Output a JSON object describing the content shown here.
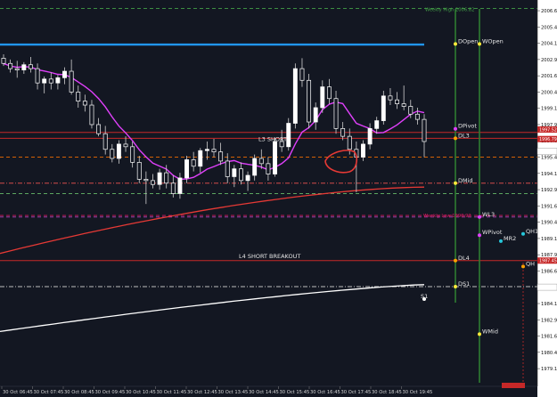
{
  "chart_data": {
    "type": "candlestick",
    "symbol_hint": "",
    "y_ticks": [
      "2006.65",
      "2005.40",
      "2004.15",
      "2002.90",
      "2001.65",
      "2000.40",
      "1999.15",
      "1997.90",
      "1996.65",
      "1995.40",
      "1994.15",
      "1992.90",
      "1991.65",
      "1990.40",
      "1989.15",
      "1987.90",
      "1986.65",
      "1985.40",
      "1984.15",
      "1982.90",
      "1981.65",
      "1980.40",
      "1979.15"
    ],
    "y_range": [
      1978.2,
      2007.2
    ],
    "x_labels": [
      "30 Oct 06:45",
      "30 Oct 07:45",
      "30 Oct 08:45",
      "30 Oct 09:45",
      "30 Oct 10:45",
      "30 Oct 11:45",
      "30 Oct 12:45",
      "30 Oct 13:45",
      "30 Oct 14:45",
      "30 Oct 15:45",
      "30 Oct 16:45",
      "30 Oct 17:45",
      "30 Oct 18:45",
      "30 Oct 19:45"
    ],
    "candles": [
      [
        2003.0,
        2003.3,
        2002.4,
        2002.6
      ],
      [
        2002.6,
        2002.9,
        2001.9,
        2002.2
      ],
      [
        2002.2,
        2002.8,
        2001.5,
        2002.1
      ],
      [
        2002.1,
        2002.7,
        2001.8,
        2002.5
      ],
      [
        2002.5,
        2003.1,
        2001.9,
        2002.2
      ],
      [
        2002.2,
        2002.6,
        2000.6,
        2001.1
      ],
      [
        2001.1,
        2001.6,
        2000.3,
        2001.4
      ],
      [
        2001.4,
        2001.9,
        2000.6,
        2001.1
      ],
      [
        2001.1,
        2001.7,
        2000.6,
        2001.5
      ],
      [
        2001.5,
        2002.3,
        2001.0,
        2002.0
      ],
      [
        2002.0,
        2002.9,
        2000.2,
        2000.4
      ],
      [
        2000.4,
        2000.9,
        1999.2,
        1999.7
      ],
      [
        1999.7,
        2000.2,
        1998.9,
        1999.4
      ],
      [
        1999.4,
        1999.8,
        1997.6,
        1997.9
      ],
      [
        1997.9,
        1998.4,
        1997.0,
        1997.2
      ],
      [
        1997.2,
        1997.8,
        1995.6,
        1996.0
      ],
      [
        1996.0,
        1996.4,
        1995.0,
        1995.3
      ],
      [
        1995.3,
        1996.7,
        1994.9,
        1996.4
      ],
      [
        1996.4,
        1997.0,
        1995.8,
        1996.2
      ],
      [
        1996.2,
        1996.6,
        1994.6,
        1995.0
      ],
      [
        1995.0,
        1995.5,
        1993.4,
        1993.7
      ],
      [
        1993.7,
        1994.3,
        1991.8,
        1993.6
      ],
      [
        1993.6,
        1994.1,
        1993.0,
        1993.3
      ],
      [
        1993.3,
        1994.5,
        1992.9,
        1994.2
      ],
      [
        1994.2,
        1994.8,
        1993.0,
        1993.4
      ],
      [
        1993.4,
        1994.0,
        1992.3,
        1992.6
      ],
      [
        1992.6,
        1994.2,
        1992.2,
        1993.8
      ],
      [
        1993.8,
        1995.5,
        1993.4,
        1995.2
      ],
      [
        1995.2,
        1995.8,
        1994.3,
        1994.7
      ],
      [
        1994.7,
        1996.1,
        1994.2,
        1995.9
      ],
      [
        1995.9,
        1996.6,
        1995.2,
        1996.0
      ],
      [
        1996.0,
        1996.8,
        1995.4,
        1995.8
      ],
      [
        1995.8,
        1996.5,
        1994.8,
        1995.1
      ],
      [
        1995.1,
        1995.7,
        1993.4,
        1993.9
      ],
      [
        1993.9,
        1994.8,
        1993.1,
        1994.5
      ],
      [
        1994.5,
        1995.0,
        1993.3,
        1993.6
      ],
      [
        1993.6,
        1994.3,
        1992.8,
        1994.0
      ],
      [
        1994.0,
        1995.6,
        1993.6,
        1995.3
      ],
      [
        1995.3,
        1996.0,
        1994.5,
        1994.9
      ],
      [
        1994.9,
        1995.4,
        1993.6,
        1994.1
      ],
      [
        1994.1,
        1996.9,
        1993.9,
        1996.6
      ],
      [
        1996.6,
        1997.5,
        1995.8,
        1996.2
      ],
      [
        1996.2,
        1998.4,
        1995.9,
        1998.0
      ],
      [
        1998.0,
        2002.6,
        1997.6,
        2002.2
      ],
      [
        2002.2,
        2003.0,
        2000.8,
        2001.3
      ],
      [
        2001.3,
        2001.8,
        1997.6,
        1998.1
      ],
      [
        1998.1,
        1999.6,
        1997.5,
        1999.2
      ],
      [
        1999.2,
        2001.3,
        1998.8,
        2000.8
      ],
      [
        2000.8,
        2001.4,
        1999.5,
        1999.9
      ],
      [
        1999.9,
        2000.5,
        1997.2,
        1997.6
      ],
      [
        1997.6,
        1998.1,
        1996.7,
        1997.0
      ],
      [
        1997.0,
        1997.6,
        1995.6,
        1996.0
      ],
      [
        1996.0,
        1996.6,
        1992.7,
        1995.4
      ],
      [
        1995.4,
        1996.7,
        1995.1,
        1996.4
      ],
      [
        1996.4,
        1998.0,
        1996.0,
        1997.6
      ],
      [
        1997.6,
        1998.5,
        1997.2,
        1998.2
      ],
      [
        1998.2,
        2000.5,
        1997.9,
        2000.1
      ],
      [
        2000.1,
        2000.7,
        1999.4,
        1999.8
      ],
      [
        1999.8,
        2000.4,
        1999.1,
        1999.5
      ],
      [
        1999.5,
        2000.9,
        1999.0,
        1999.3
      ],
      [
        1999.3,
        1999.8,
        1998.4,
        1998.7
      ],
      [
        1998.7,
        1999.2,
        1997.9,
        1998.3
      ],
      [
        1998.3,
        1998.7,
        1995.4,
        1996.6
      ]
    ],
    "indicators": [
      {
        "name": "ma_magenta",
        "color": "#e040fb"
      },
      {
        "name": "ma_red",
        "color": "#e53935"
      },
      {
        "name": "ma_white",
        "color": "#ffffff"
      }
    ],
    "levels": [
      {
        "id": "weekly-high",
        "label": "Weekly High 2006.82",
        "value": 2006.82,
        "color": "#43a047",
        "style": "dashed",
        "label_color": "#43a047"
      },
      {
        "id": "blue",
        "label": "",
        "value": 2004.05,
        "color": "#2196f3",
        "style": "solid",
        "label_color": "#2196f3"
      },
      {
        "id": "dpivot",
        "label": "DPivot",
        "value": 1997.3,
        "color": "#c62828",
        "style": "solid",
        "label_color": "#e6e6e6"
      },
      {
        "id": "l3",
        "label": "L3 SHORT",
        "value": 1996.85,
        "color": "#c62828",
        "style": "solid",
        "label_color": "#e6e6e6"
      },
      {
        "id": "orange",
        "label": "",
        "value": 1995.4,
        "color": "#ef6c00",
        "style": "dashed",
        "label_color": "#ef6c00"
      },
      {
        "id": "dmid",
        "label": "DMid",
        "value": 1993.4,
        "color": "#ef5350",
        "style": "dashdot",
        "label_color": "#e6e6e6"
      },
      {
        "id": "green-dash",
        "label": "",
        "value": 1992.6,
        "color": "#66bb6a",
        "style": "dashed",
        "label_color": "#66bb6a"
      },
      {
        "id": "weekly-low",
        "label": "Weekly Low 1990.92",
        "value": 1990.92,
        "color": "#d81b60",
        "style": "dashed",
        "label_color": "#d81b60"
      },
      {
        "id": "wl3",
        "label": "WL3",
        "value": 1990.8,
        "color": "#ab47bc",
        "style": "dashed",
        "label_color": "#e6e6e6"
      },
      {
        "id": "l4",
        "label": "L4 SHORT BREAKOUT",
        "value": 1987.45,
        "color": "#c62828",
        "style": "solid",
        "label_color": "#e6e6e6"
      },
      {
        "id": "ds1",
        "label": "DS1",
        "value": 1985.45,
        "color": "#bdbdbd",
        "style": "dashdot",
        "label_color": "#e6e6e6"
      }
    ],
    "price_tags": [
      {
        "id": "tag-dpivot",
        "text": "1997.52",
        "value": 1997.52,
        "bg": "#c62828"
      },
      {
        "id": "tag-l3",
        "text": "1996.79",
        "value": 1996.79,
        "bg": "#c62828"
      },
      {
        "id": "tag-orange",
        "text": "1995.85",
        "value": 1995.85,
        "bg": "#ffffff"
      },
      {
        "id": "tag-l4",
        "text": "1987.45",
        "value": 1987.45,
        "bg": "#c62828"
      },
      {
        "id": "tag-ds1",
        "text": "1985.41",
        "value": 1985.41,
        "bg": "#ffffff"
      }
    ],
    "markers": [
      {
        "id": "dopen",
        "label": "DOpen",
        "value": 2004.1,
        "dot": "#ffeb3b"
      },
      {
        "id": "wopen",
        "label": "WOpen",
        "value": 2004.1,
        "dot": "#ffeb3b"
      },
      {
        "id": "dpivot-m",
        "label": "DPivot",
        "value": 1997.3,
        "dot": "#e040fb"
      },
      {
        "id": "dl3",
        "label": "DL3",
        "value": 1996.85,
        "dot": "#ffa000"
      },
      {
        "id": "dmid-m",
        "label": "DMid",
        "value": 1993.4,
        "dot": "#ffeb3b"
      },
      {
        "id": "wl3-m",
        "label": "WL3",
        "value": 1990.8,
        "dot": "#e040fb"
      },
      {
        "id": "wpivot",
        "label": "WPivot",
        "value": 1989.4,
        "dot": "#e040fb"
      },
      {
        "id": "mr2",
        "label": "MR2",
        "value": 1988.95,
        "dot": "#26c6da"
      },
      {
        "id": "qh1",
        "label": "QH1",
        "value": 1989.5,
        "dot": "#26c6da"
      },
      {
        "id": "dl4",
        "label": "DL4",
        "value": 1987.45,
        "dot": "#ffa000"
      },
      {
        "id": "qh-bottom",
        "label": "QH",
        "value": 1987.0,
        "dot": "#ffa000"
      },
      {
        "id": "ds1-m",
        "label": "DS1",
        "value": 1985.45,
        "dot": "#ffeb3b"
      },
      {
        "id": "s1",
        "label": "S1",
        "value": 1984.9,
        "dot": "#ffffff"
      },
      {
        "id": "wmid",
        "label": "WMid",
        "value": 1981.8,
        "dot": "#ffeb3b"
      }
    ],
    "grid": false
  }
}
